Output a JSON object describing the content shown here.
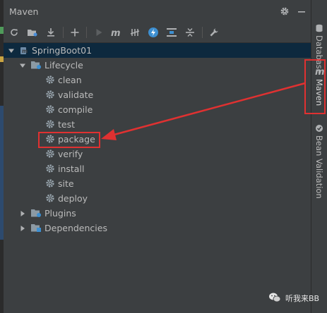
{
  "window": {
    "title": "Maven"
  },
  "tree": {
    "project": {
      "label": "SpringBoot01"
    },
    "lifecycle": {
      "label": "Lifecycle",
      "goals": [
        "clean",
        "validate",
        "compile",
        "test",
        "package",
        "verify",
        "install",
        "site",
        "deploy"
      ]
    },
    "plugins": {
      "label": "Plugins"
    },
    "dependencies": {
      "label": "Dependencies"
    }
  },
  "right_tabs": {
    "database": "Database",
    "maven": "Maven",
    "bean_validation": "Bean Validation"
  },
  "watermark": {
    "text": "听我来BB"
  },
  "colors": {
    "panel_bg": "#3c3f41",
    "selection_bg": "#0d293e",
    "annotation_red": "#e03131",
    "text": "#bbbbbb",
    "gear": "#9aa7b0",
    "folder": "#8c9aa4"
  }
}
